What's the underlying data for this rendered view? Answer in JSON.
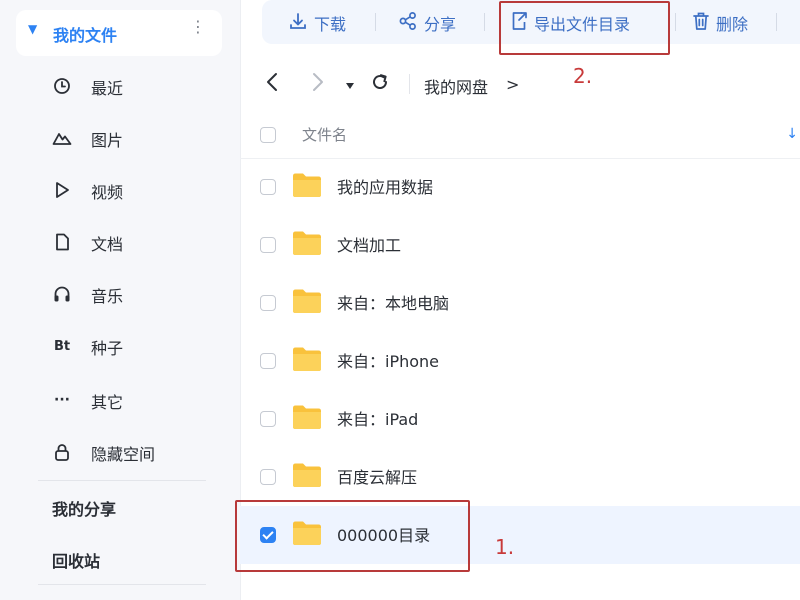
{
  "sidebar": {
    "my_files_label": "我的文件",
    "items": [
      {
        "label": "最近",
        "icon": "clock-icon"
      },
      {
        "label": "图片",
        "icon": "mountain-icon"
      },
      {
        "label": "视频",
        "icon": "play-icon"
      },
      {
        "label": "文档",
        "icon": "document-icon"
      },
      {
        "label": "音乐",
        "icon": "headphones-icon"
      },
      {
        "label": "种子",
        "icon": "bt-icon",
        "glyph": "Bt"
      },
      {
        "label": "其它",
        "icon": "ellipsis-icon",
        "glyph": "···"
      },
      {
        "label": "隐藏空间",
        "icon": "lock-icon"
      }
    ],
    "my_share_label": "我的分享",
    "recycle_label": "回收站"
  },
  "toolbar": {
    "download_label": "下载",
    "share_label": "分享",
    "export_label": "导出文件目录",
    "delete_label": "删除"
  },
  "nav": {
    "breadcrumb": "我的网盘",
    "chevron": ">"
  },
  "list": {
    "header_name": "文件名",
    "sort_glyph": "↓",
    "rows": [
      {
        "name": "我的应用数据",
        "checked": false
      },
      {
        "name": "文档加工",
        "checked": false
      },
      {
        "name": "来自：本地电脑",
        "checked": false
      },
      {
        "name": "来自：iPhone",
        "checked": false
      },
      {
        "name": "来自：iPad",
        "checked": false
      },
      {
        "name": "百度云解压",
        "checked": false
      },
      {
        "name": "000000目录",
        "checked": true
      }
    ]
  },
  "annotations": {
    "step1": "1.",
    "step2": "2."
  },
  "colors": {
    "accent": "#2d82f3",
    "annotation": "#c83a3a",
    "folder": "#f9c23c"
  }
}
